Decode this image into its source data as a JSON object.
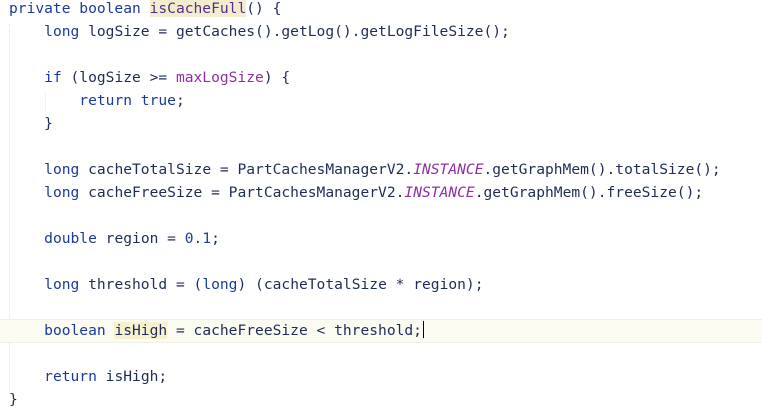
{
  "editor": {
    "lines": [
      {
        "id": "signature",
        "tokens": [
          {
            "t": "private boolean ",
            "c": "kw"
          },
          {
            "t": "isCacheFull",
            "c": "fn-decl"
          },
          {
            "t": "() {",
            "c": ""
          }
        ]
      },
      {
        "id": "log-size",
        "tokens": [
          {
            "t": "    ",
            "c": ""
          },
          {
            "t": "long ",
            "c": "kw"
          },
          {
            "t": "logSize = getCaches().getLog().getLogFileSize();",
            "c": ""
          }
        ]
      },
      {
        "id": "blank-1",
        "tokens": []
      },
      {
        "id": "if-check",
        "tokens": [
          {
            "t": "    ",
            "c": ""
          },
          {
            "t": "if ",
            "c": "kw"
          },
          {
            "t": "(logSize >= ",
            "c": ""
          },
          {
            "t": "maxLogSize",
            "c": "field"
          },
          {
            "t": ") {",
            "c": ""
          }
        ]
      },
      {
        "id": "return-true",
        "tokens": [
          {
            "t": "        ",
            "c": ""
          },
          {
            "t": "return true",
            "c": "kw"
          },
          {
            "t": ";",
            "c": ""
          }
        ]
      },
      {
        "id": "close-if",
        "tokens": [
          {
            "t": "    }",
            "c": ""
          }
        ]
      },
      {
        "id": "blank-2",
        "tokens": []
      },
      {
        "id": "cache-total",
        "tokens": [
          {
            "t": "    ",
            "c": ""
          },
          {
            "t": "long ",
            "c": "kw"
          },
          {
            "t": "cacheTotalSize = PartCachesManagerV2.",
            "c": ""
          },
          {
            "t": "INSTANCE",
            "c": "static-field"
          },
          {
            "t": ".getGraphMem().totalSize();",
            "c": ""
          }
        ]
      },
      {
        "id": "cache-free",
        "tokens": [
          {
            "t": "    ",
            "c": ""
          },
          {
            "t": "long ",
            "c": "kw"
          },
          {
            "t": "cacheFreeSize = PartCachesManagerV2.",
            "c": ""
          },
          {
            "t": "INSTANCE",
            "c": "static-field"
          },
          {
            "t": ".getGraphMem().freeSize();",
            "c": ""
          }
        ]
      },
      {
        "id": "blank-3",
        "tokens": []
      },
      {
        "id": "region",
        "tokens": [
          {
            "t": "    ",
            "c": ""
          },
          {
            "t": "double ",
            "c": "kw"
          },
          {
            "t": "region = ",
            "c": ""
          },
          {
            "t": "0.1",
            "c": "num"
          },
          {
            "t": ";",
            "c": ""
          }
        ]
      },
      {
        "id": "blank-4",
        "tokens": []
      },
      {
        "id": "threshold",
        "tokens": [
          {
            "t": "    ",
            "c": ""
          },
          {
            "t": "long ",
            "c": "kw"
          },
          {
            "t": "threshold = (",
            "c": ""
          },
          {
            "t": "long",
            "c": "kw"
          },
          {
            "t": ") (cacheTotalSize * region);",
            "c": ""
          }
        ]
      },
      {
        "id": "blank-5",
        "tokens": []
      },
      {
        "id": "is-high",
        "current": true,
        "tokens": [
          {
            "t": "    ",
            "c": ""
          },
          {
            "t": "boolean ",
            "c": "kw"
          },
          {
            "t": "isHigh",
            "c": "var-hl"
          },
          {
            "t": " = cacheFreeSize < threshold;",
            "c": ""
          }
        ]
      },
      {
        "id": "blank-6",
        "tokens": []
      },
      {
        "id": "return-is-high",
        "tokens": [
          {
            "t": "    ",
            "c": ""
          },
          {
            "t": "return ",
            "c": "kw"
          },
          {
            "t": "isHigh;",
            "c": ""
          }
        ]
      },
      {
        "id": "close-method",
        "tokens": [
          {
            "t": "}",
            "c": ""
          }
        ]
      }
    ]
  }
}
